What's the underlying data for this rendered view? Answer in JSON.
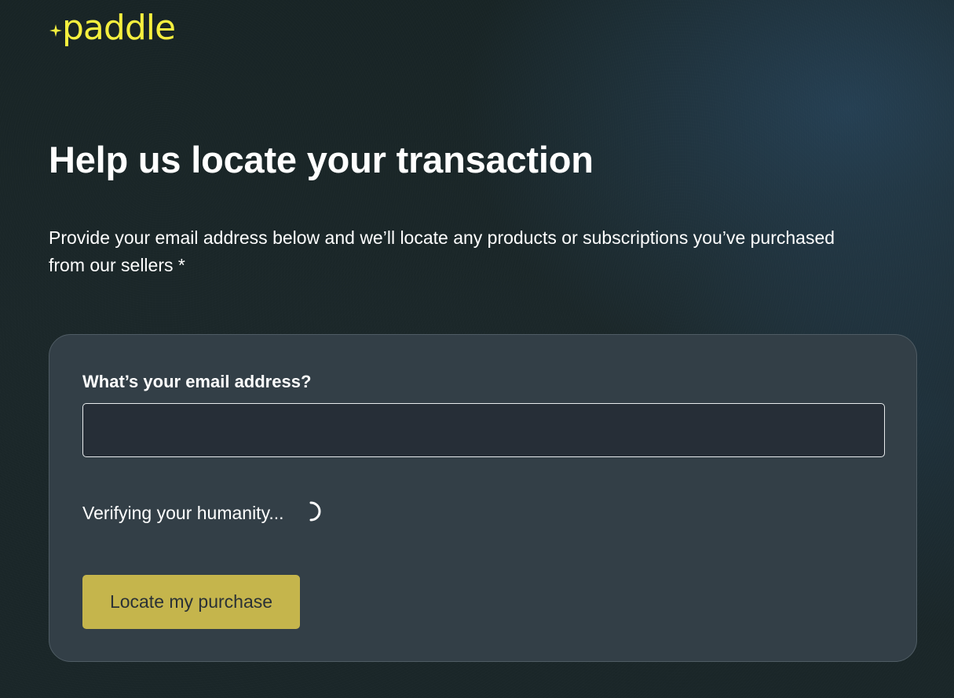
{
  "brand": {
    "name": "paddle",
    "icon": "sparkle-icon",
    "color": "#f5ef3e"
  },
  "heading": "Help us locate your transaction",
  "intro": "Provide your email address below and we’ll locate any products or subscriptions you’ve purchased from our sellers *",
  "form": {
    "email_label": "What’s your email address?",
    "email_value": "",
    "email_placeholder": "",
    "verification_status": "Verifying your humanity...",
    "verification_icon": "loading-spinner-icon",
    "submit_label": "Locate my purchase"
  },
  "colors": {
    "background": "#1b2729",
    "card": "#333f47",
    "input": "#262e37",
    "button": "#c5b54c",
    "button_text": "#2a3136"
  }
}
